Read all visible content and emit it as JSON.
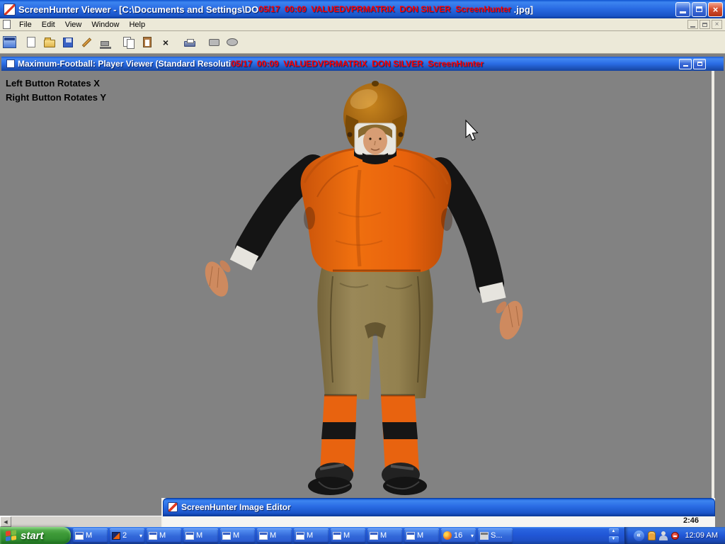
{
  "window": {
    "title_left": "ScreenHunter Viewer - [C:\\Documents and Settings\\DO",
    "stamp": "05/17  00:09  VALUEDVPRMATRIX  DON SILVER  ScreenHunter",
    "title_right": " .jpg]"
  },
  "menubar": {
    "items": [
      "File",
      "Edit",
      "View",
      "Window",
      "Help"
    ]
  },
  "mdi_window": {
    "title": "Maximum-Football: Player Viewer (Standard Resoluti",
    "stamp": "05/17  00:09  VALUEDVPRMATRIX  DON SILVER  ScreenHunter",
    "hints": {
      "line1": "Left Button Rotates X",
      "line2": "Right Button Rotates Y"
    }
  },
  "editor_window": {
    "title": "ScreenHunter Image Editor",
    "snippet": "2:46"
  },
  "taskbar": {
    "start_label": "start",
    "buttons": [
      {
        "label": "M"
      },
      {
        "label": "2",
        "arrow": "▾"
      },
      {
        "label": "M"
      },
      {
        "label": "M"
      },
      {
        "label": "M"
      },
      {
        "label": "M"
      },
      {
        "label": "M"
      },
      {
        "label": "M"
      },
      {
        "label": "M"
      },
      {
        "label": "M"
      },
      {
        "label": "16",
        "arrow": "▾"
      },
      {
        "label": "S..."
      }
    ],
    "clock": "12:09 AM"
  },
  "glyphs": {
    "close_x": "×",
    "delete_x": "×",
    "scroll_left": "◀",
    "scroll_up": "▲",
    "scroll_down": "▼",
    "chevron": "«"
  },
  "colors": {
    "titlebar_blue": "#2A6CE4",
    "stamp_red": "#FF0000",
    "client_gray": "#828282",
    "menubar_tan": "#ECE9D8",
    "taskbar_blue": "#2157D7",
    "start_green": "#3D9A37",
    "jersey_orange": "#E8600F",
    "pants_khaki": "#8E7C4E",
    "sock_orange": "#E8630F",
    "sleeve_black": "#141414",
    "helmet_brown": "#9A5E10",
    "skin": "#D79D74"
  }
}
